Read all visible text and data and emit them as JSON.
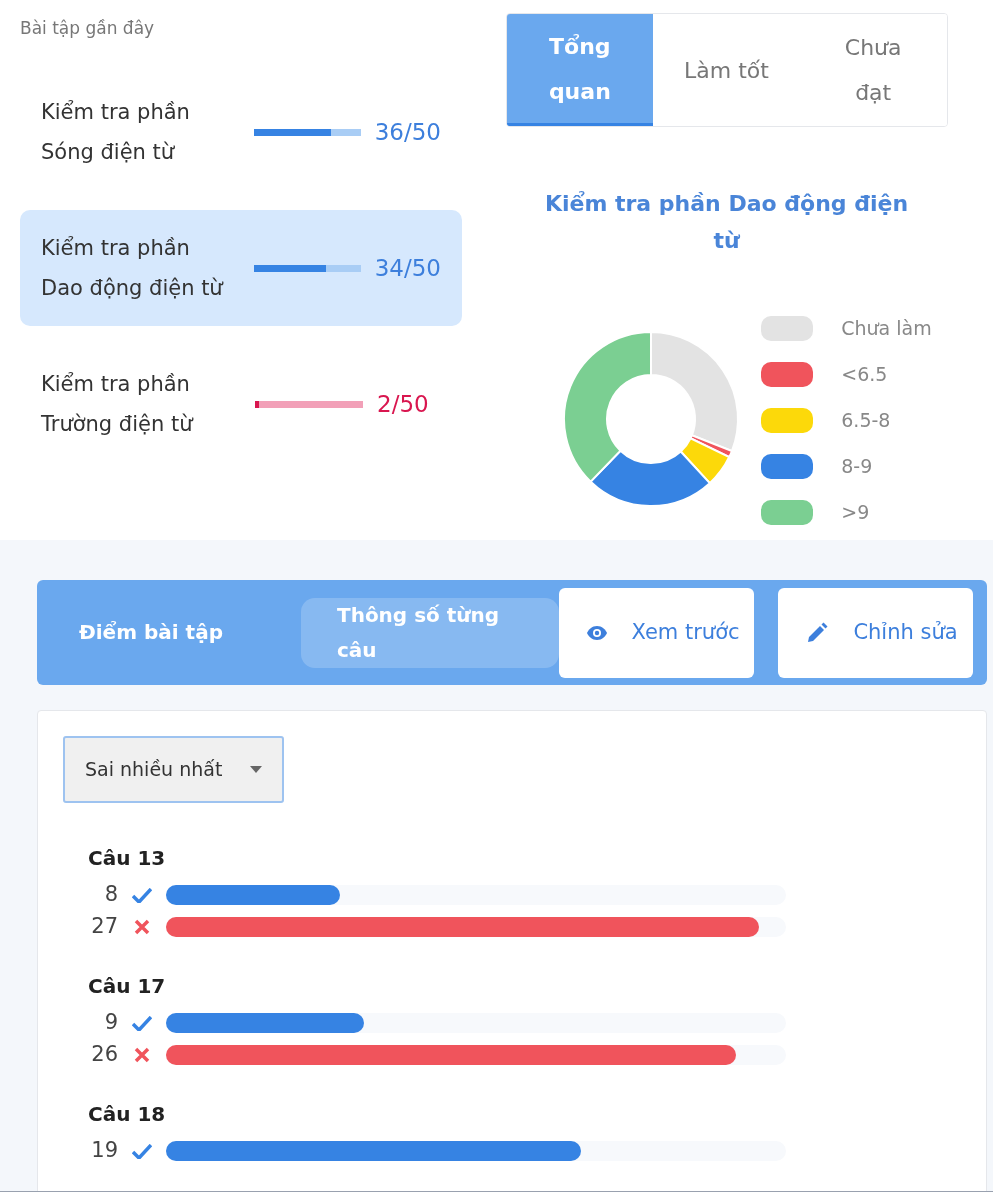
{
  "recent": {
    "title": "Bài tập gần đây",
    "items": [
      {
        "name": "Kiểm tra phần Sóng điện từ",
        "score": "36/50",
        "level": 0.72,
        "kind": "pass",
        "selected": false
      },
      {
        "name": "Kiểm tra phần Dao động điện từ",
        "score": "34/50",
        "level": 0.68,
        "kind": "pass",
        "selected": true
      },
      {
        "name": "Kiểm tra phần Trường điện từ",
        "score": "2/50",
        "level": 0.04,
        "kind": "fail",
        "selected": false
      }
    ]
  },
  "overview": {
    "tabs": [
      {
        "label": "Tổng quan",
        "selected": true
      },
      {
        "label": "Làm tốt",
        "selected": false
      },
      {
        "label": "Chưa đạt",
        "selected": false
      }
    ],
    "chart_title": "Kiểm tra phần Dao động điện từ",
    "legend": [
      {
        "label": "Chưa làm",
        "color": "#e3e3e3"
      },
      {
        "label": "<6.5",
        "color": "#f0545c"
      },
      {
        "label": "6.5-8",
        "color": "#fcd90a"
      },
      {
        "label": "8-9",
        "color": "#3683e3"
      },
      {
        "label": ">9",
        "color": "#7bcf92"
      }
    ]
  },
  "toolbar": {
    "tabs": [
      {
        "label": "Điểm bài tập",
        "selected": false
      },
      {
        "label": "Thông số từng câu",
        "selected": true
      }
    ],
    "buttons": [
      {
        "label": "Xem trước",
        "kind": "preview"
      },
      {
        "label": "Chỉnh sửa",
        "kind": "edit"
      }
    ]
  },
  "stats": {
    "sort": "Sai nhiều nhất",
    "questions": [
      {
        "label": "Câu 13",
        "rows": [
          {
            "count": "8",
            "kind": "correct",
            "level": 0.28
          },
          {
            "count": "27",
            "kind": "wrong",
            "level": 0.956
          }
        ]
      },
      {
        "label": "Câu 17",
        "rows": [
          {
            "count": "9",
            "kind": "correct",
            "level": 0.32
          },
          {
            "count": "26",
            "kind": "wrong",
            "level": 0.92
          }
        ]
      },
      {
        "label": "Câu 18",
        "rows": [
          {
            "count": "19",
            "kind": "correct",
            "level": 0.67
          }
        ]
      }
    ]
  }
}
